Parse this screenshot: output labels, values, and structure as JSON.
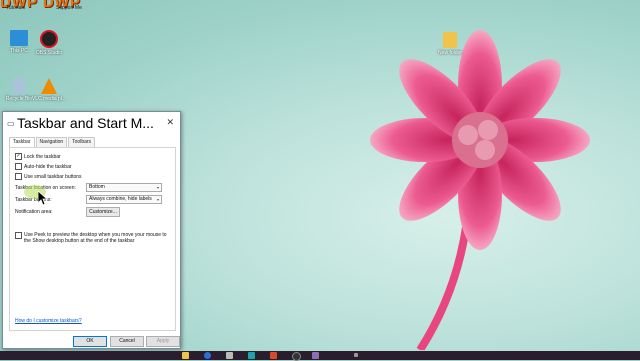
{
  "watermark": {
    "text": "DWP DWP",
    "sub_left": "Tutorials",
    "sub_right": "Support Me"
  },
  "desktop": {
    "icons": [
      {
        "label": "This PC"
      },
      {
        "label": "OBS Studio"
      },
      {
        "label": "Recycle Bin"
      },
      {
        "label": "VLC media pl..."
      },
      {
        "label": "New folder"
      }
    ]
  },
  "dialog": {
    "title": "Taskbar and Start M...",
    "tabs": [
      "Taskbar",
      "Navigation",
      "Toolbars"
    ],
    "options": {
      "lock": "Lock the taskbar",
      "autohide": "Auto-hide the taskbar",
      "small": "Use small taskbar buttons",
      "location_label": "Taskbar location on screen:",
      "location_value": "Bottom",
      "buttons_label": "Taskbar buttons:",
      "buttons_value": "Always combine, hide labels",
      "notification_label": "Notification area:",
      "customize": "Customize...",
      "peek": "Use Peek to preview the desktop when you move your mouse to the Show desktop button at the end of the taskbar",
      "help_link": "How do I customize taskbars?"
    },
    "buttons": {
      "ok": "OK",
      "cancel": "Cancel",
      "apply": "Apply"
    }
  },
  "colors": {
    "accent": "#0078d7",
    "flower": "#e8467f",
    "taskbar": "#2a1e2e"
  }
}
